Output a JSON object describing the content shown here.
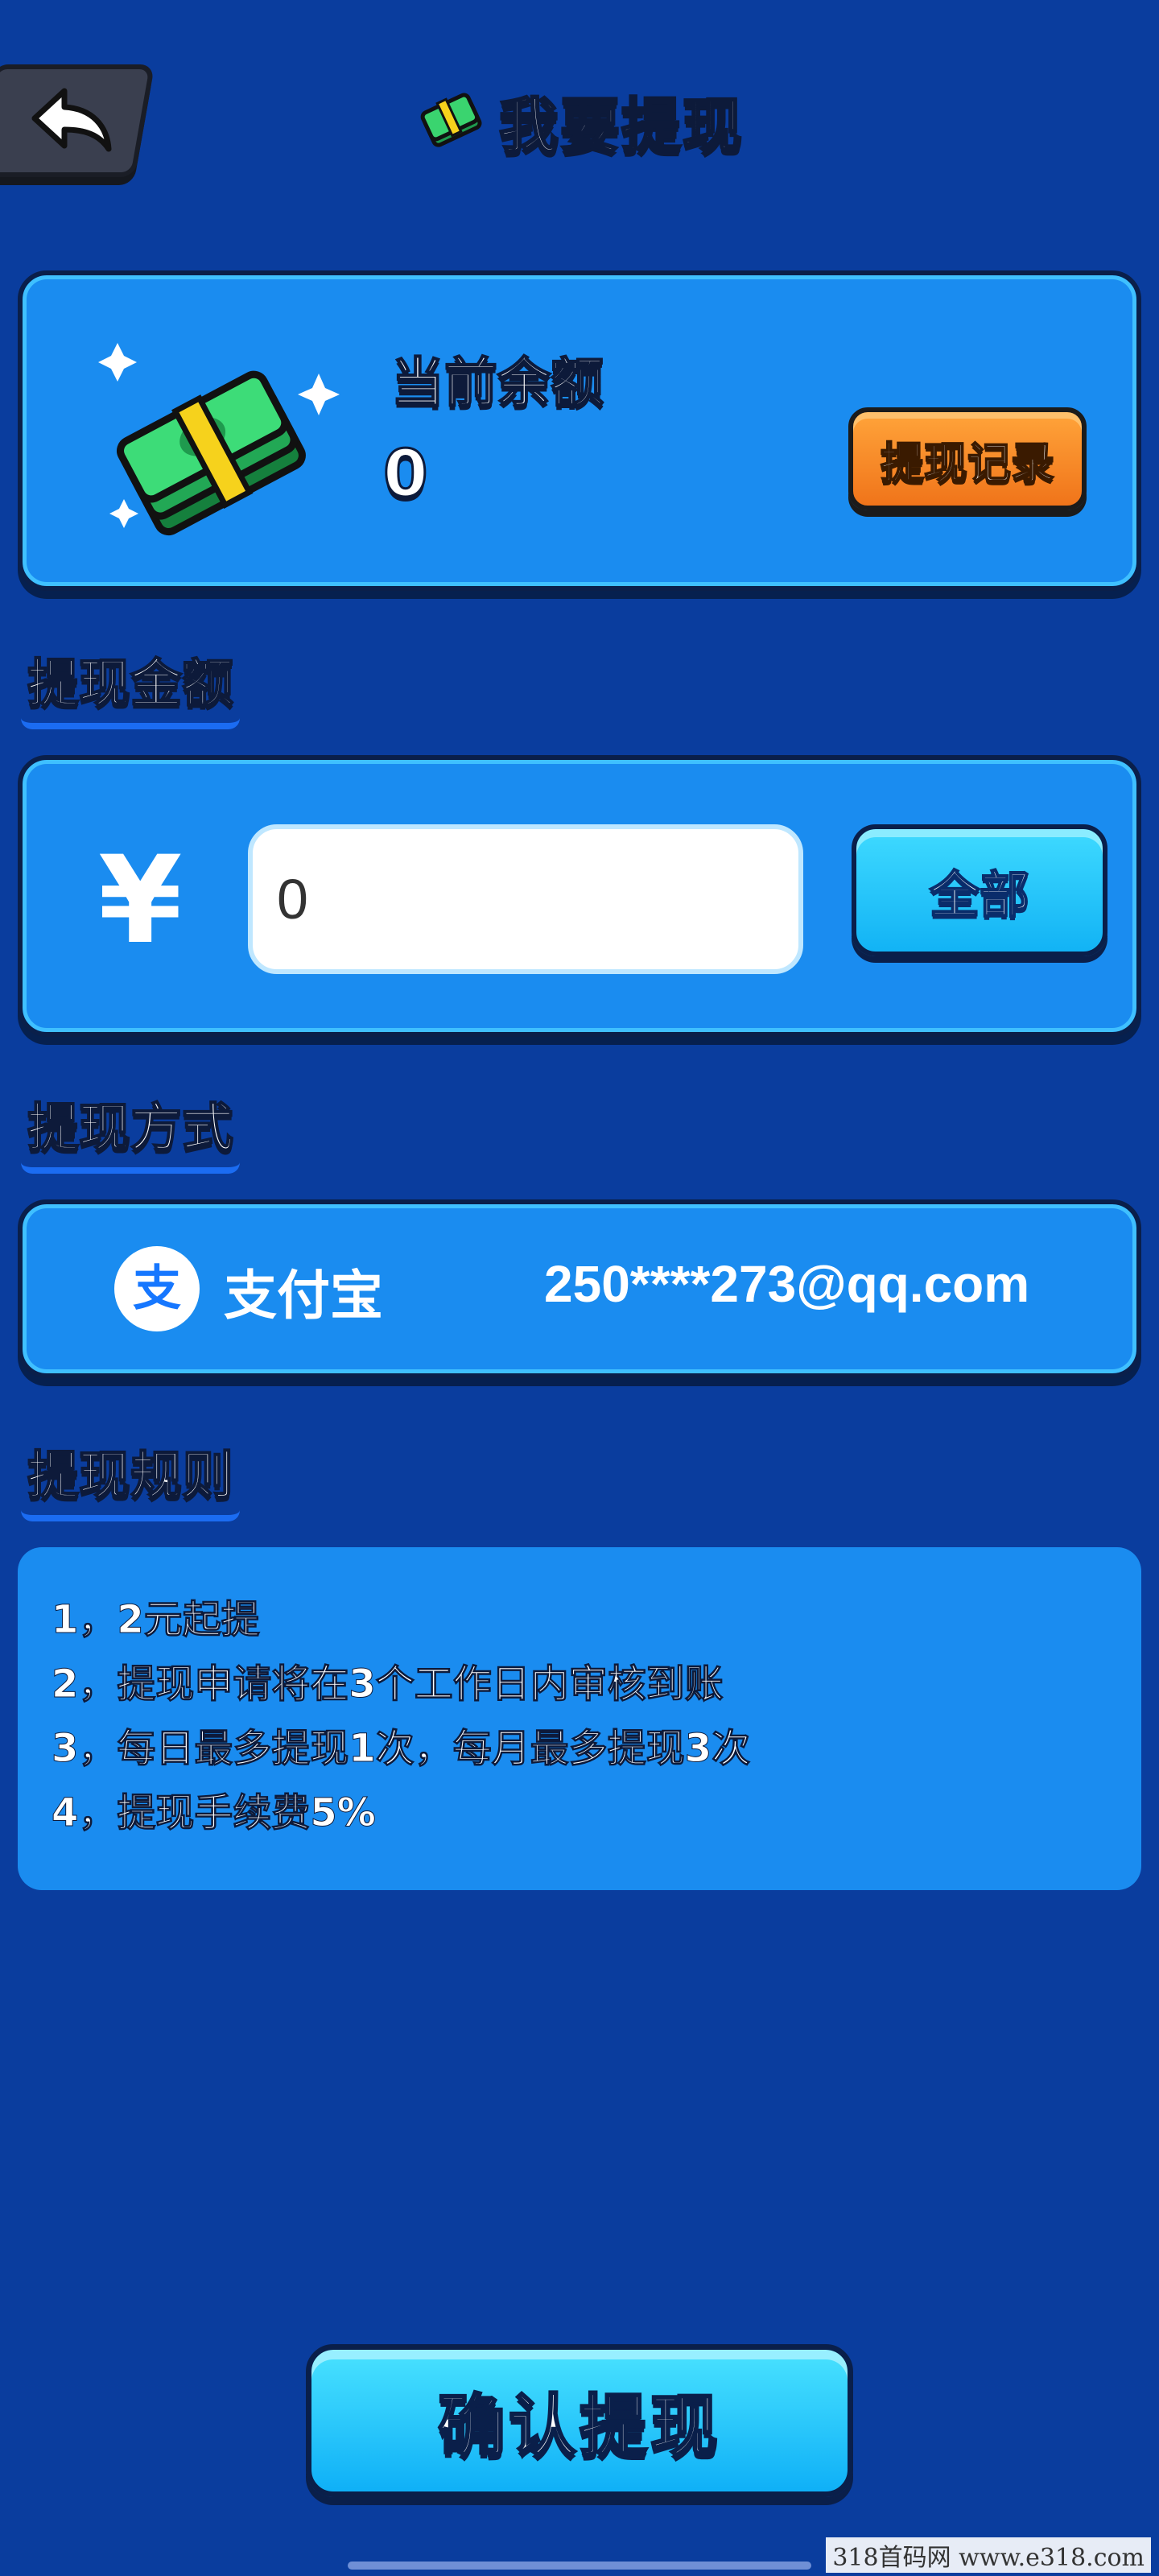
{
  "header": {
    "back_icon": "back-arrow-icon",
    "title_icon": "money-stack-icon",
    "title": "我要提现"
  },
  "balance": {
    "label": "当前余额",
    "value": "0",
    "history_button": "提现记录"
  },
  "amount_section": {
    "label": "提现金额",
    "currency_symbol": "¥",
    "input_value": "0",
    "all_button": "全部"
  },
  "method_section": {
    "label": "提现方式",
    "provider_icon": "alipay-icon",
    "provider_name": "支付宝",
    "account": "250****273@qq.com"
  },
  "rules_section": {
    "label": "提现规则",
    "rules": [
      "1，2元起提",
      "2，提现申请将在3个工作日内审核到账",
      "3，每日最多提现1次，每月最多提现3次",
      "4，提现手续费5%"
    ]
  },
  "confirm_button": "确认提现",
  "watermark": "318首码网 www.e318.com",
  "colors": {
    "background": "#0a3d9e",
    "card": "#1a8cf0",
    "orange_button": "#f0741a",
    "cyan_button": "#12b3f5"
  }
}
